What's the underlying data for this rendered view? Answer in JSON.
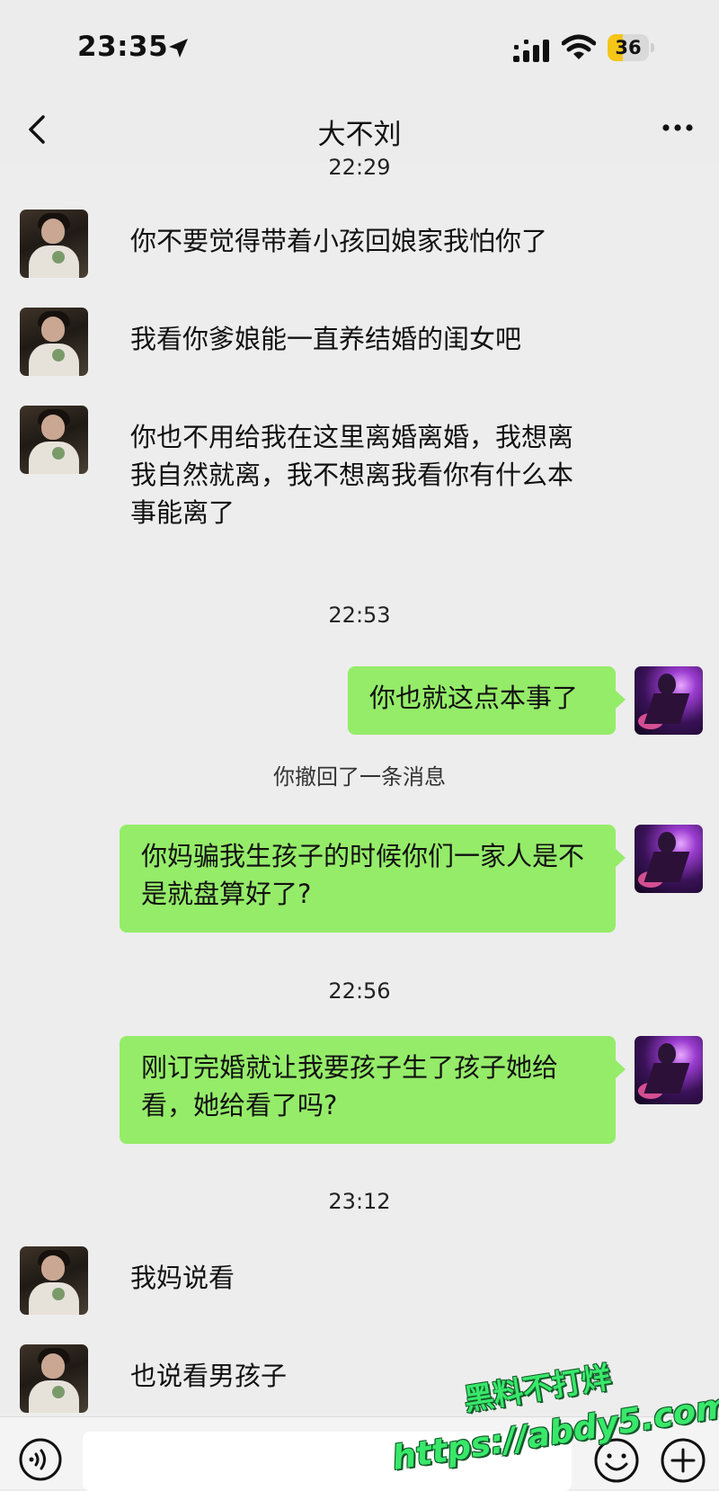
{
  "status_bar": {
    "time": "23:35",
    "battery": "36",
    "battery_level": 0.36
  },
  "header": {
    "title": "大不刘"
  },
  "chat": {
    "timestamps": [
      "22:29",
      "22:53",
      "22:56",
      "23:12"
    ],
    "messages_left_1": [
      "你不要觉得带着小孩回娘家我怕你了",
      "我看你爹娘能一直养结婚的闺女吧",
      "你也不用给我在这里离婚离婚，我想离我自然就离，我不想离我看你有什么本事能离了"
    ],
    "messages_right": [
      "你也就这点本事了",
      "你妈骗我生孩子的时候你们一家人是不是就盘算好了?",
      "刚订完婚就让我要孩子生了孩子她给看，她给看了吗?"
    ],
    "system_notice": "你撤回了一条消息",
    "messages_left_2": [
      "我妈说看",
      "也说看男孩子"
    ]
  },
  "watermark": {
    "line1": "黑料不打烊",
    "line2": "https://abdy5.com"
  },
  "colors": {
    "bubble_green": "#95ec69",
    "background": "#ededed",
    "watermark_green": "#38e86a"
  },
  "icons": [
    "location-arrow-icon",
    "signal-icon",
    "wifi-icon",
    "back-chevron-icon",
    "more-dots-icon",
    "voice-icon",
    "emoji-icon",
    "plus-icon"
  ]
}
